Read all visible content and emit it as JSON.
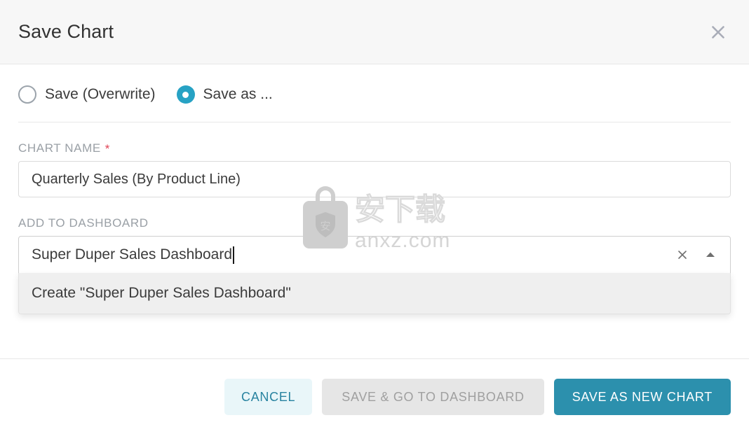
{
  "header": {
    "title": "Save Chart",
    "close_icon": "close-icon"
  },
  "save_mode": {
    "options": [
      {
        "label": "Save (Overwrite)",
        "selected": false
      },
      {
        "label": "Save as ...",
        "selected": true
      }
    ]
  },
  "chart_name": {
    "label": "CHART NAME",
    "required_marker": "*",
    "value": "Quarterly Sales (By Product Line)",
    "placeholder": "Name your chart"
  },
  "dashboard": {
    "label": "ADD TO DASHBOARD",
    "value": "Super Duper Sales Dashboard",
    "placeholder": "Select a dashboard",
    "clear_icon": "close-small-icon",
    "toggle_icon": "caret-up-icon",
    "expanded": true,
    "options": [
      {
        "label": "Create \"Super Duper Sales Dashboard\"",
        "highlighted": true
      }
    ]
  },
  "footer": {
    "cancel_label": "CANCEL",
    "save_go_label": "SAVE & GO TO DASHBOARD",
    "save_new_label": "SAVE AS NEW CHART"
  },
  "watermark": {
    "site": "anxz.com",
    "glyphs": "安下载",
    "badge_glyph": "安"
  },
  "colors": {
    "accent": "#27a2c4",
    "primary_button": "#2c90ad",
    "cancel_text": "#2883a0",
    "cancel_bg": "#e9f6f9",
    "required": "#e04355",
    "header_bg": "#f7f7f7",
    "disabled_bg": "#e6e6e6",
    "disabled_text": "#a0a0a0",
    "label_text": "#9aa0a6"
  }
}
